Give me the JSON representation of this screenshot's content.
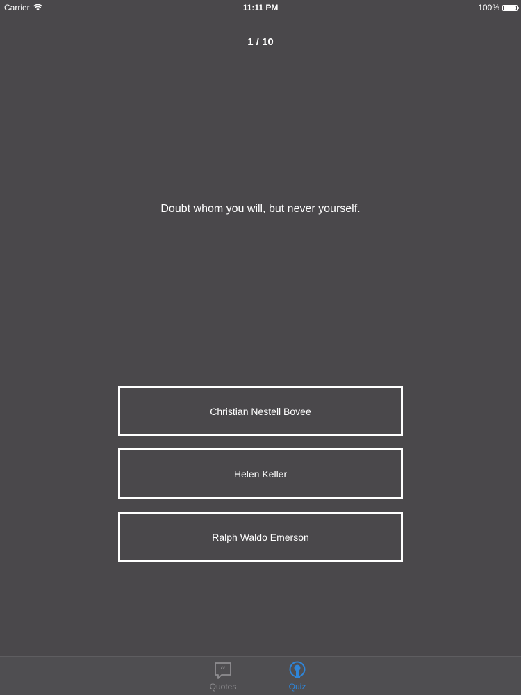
{
  "status_bar": {
    "carrier": "Carrier",
    "time": "11:11 PM",
    "battery": "100%",
    "battery_level": 1.0
  },
  "quiz": {
    "progress": "1 / 10",
    "quote": "Doubt whom you will, but never yourself.",
    "answers": [
      "Christian Nestell Bovee",
      "Helen Keller",
      "Ralph Waldo Emerson"
    ]
  },
  "tab_bar": {
    "tabs": [
      {
        "label": "Quotes",
        "icon": "quote-bubble-icon",
        "selected": false,
        "color": "#8e8d90"
      },
      {
        "label": "Quiz",
        "icon": "lightbulb-icon",
        "selected": true,
        "color": "#2f85d8"
      }
    ]
  },
  "colors": {
    "background": "#4a484b",
    "tab_bar_background": "#4f4e51",
    "accent": "#2f85d8",
    "text": "#ffffff"
  }
}
